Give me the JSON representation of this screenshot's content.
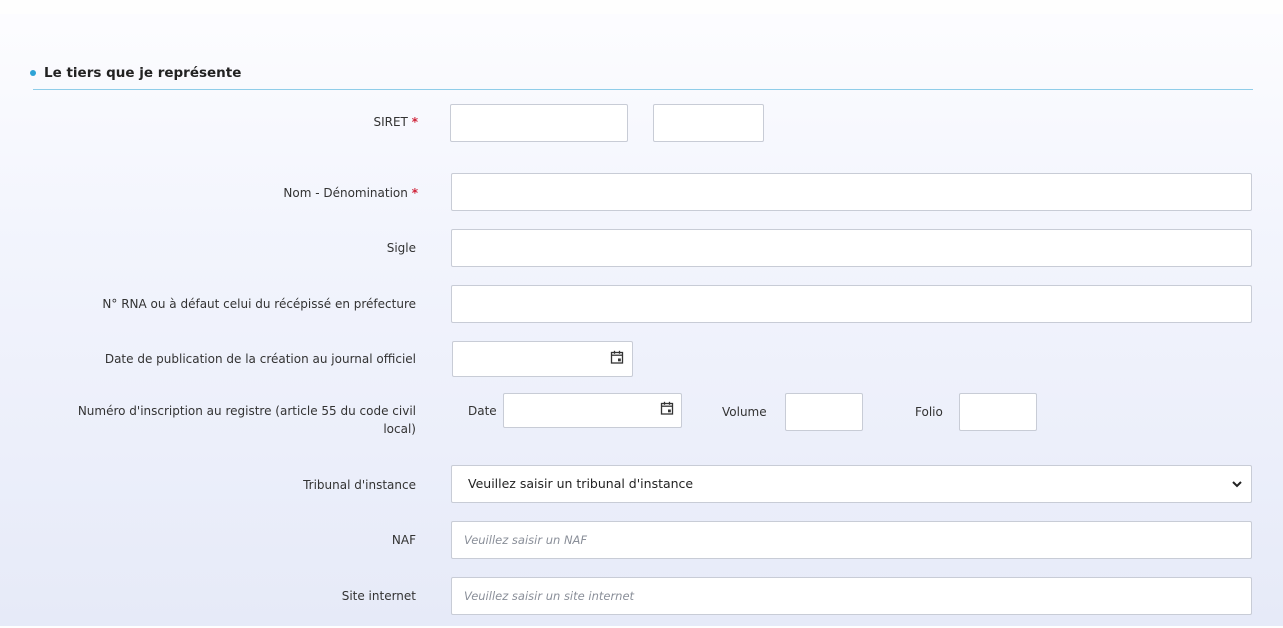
{
  "section": {
    "title": "Le tiers que je représente"
  },
  "fields": {
    "siret": {
      "label": "SIRET",
      "required_mark": "*"
    },
    "nom": {
      "label": "Nom - Dénomination",
      "required_mark": "*"
    },
    "sigle": {
      "label": "Sigle"
    },
    "rna": {
      "label": "N° RNA ou à défaut celui du récépissé en préfecture"
    },
    "date_publication": {
      "label": "Date de publication de la création au journal officiel"
    },
    "registre": {
      "label_line1": "Numéro d'inscription au registre (article 55 du code civil",
      "label_line2": "local)",
      "date_label": "Date",
      "volume_label": "Volume",
      "folio_label": "Folio"
    },
    "tribunal": {
      "label": "Tribunal d'instance",
      "selected": "Veuillez saisir un tribunal d'instance"
    },
    "naf": {
      "label": "NAF",
      "placeholder": "Veuillez saisir un NAF"
    },
    "site": {
      "label": "Site internet",
      "placeholder": "Veuillez saisir un site internet"
    }
  },
  "icons": {
    "calendar": "calendar-icon",
    "chevron": "chevron-down-icon"
  },
  "colors": {
    "accent": "#2ea3d6",
    "required": "#d0243a",
    "divider": "#8fcde9"
  }
}
